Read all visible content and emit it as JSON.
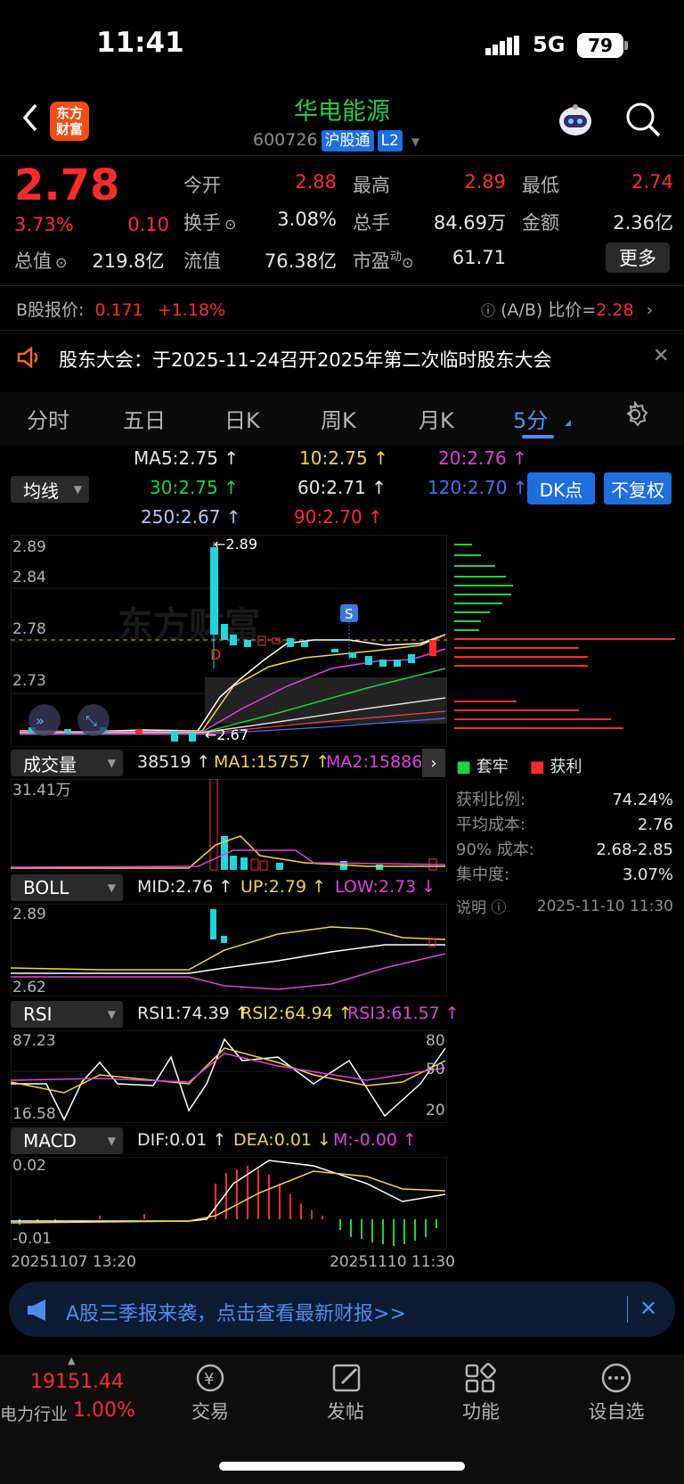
{
  "status": {
    "time": "11:41",
    "network": "5G",
    "battery": "79"
  },
  "header": {
    "logo_line1": "东方",
    "logo_line2": "财富",
    "name": "华电能源",
    "code": "600726",
    "tag1": "沪股通",
    "tag2": "L2"
  },
  "quote": {
    "price": "2.78",
    "pct": "3.73%",
    "chg": "0.10",
    "cap_label": "总值",
    "cap_value": "219.8亿",
    "open_label": "今开",
    "open": "2.88",
    "high_label": "最高",
    "high": "2.89",
    "low_label": "最低",
    "low": "2.74",
    "turnover_label": "换手",
    "turnover": "3.08%",
    "volume_label": "总手",
    "volume": "84.69万",
    "amount_label": "金额",
    "amount": "2.36亿",
    "float_label": "流值",
    "float": "76.38亿",
    "pe_label": "市盈",
    "pe_sup": "动",
    "pe": "61.71",
    "more": "更多"
  },
  "bshare": {
    "label": "B股报价:",
    "price": "0.171",
    "pct": "+1.18%",
    "ratio_label": "(A/B) 比价=",
    "ratio": "2.28"
  },
  "notice": {
    "text": "股东大会：于2025-11-24召开2025年第二次临时股东大会"
  },
  "tabs": [
    "分时",
    "五日",
    "日K",
    "周K",
    "月K",
    "5分"
  ],
  "ma": {
    "selector": "均线",
    "ma5": "MA5:2.75",
    "ma10": "10:2.75",
    "ma20": "20:2.76",
    "ma30": "30:2.75",
    "ma60": "60:2.71",
    "ma120": "120:2.70",
    "ma250": "250:2.67",
    "ma90": "90:2.70",
    "dk": "DK点",
    "fq": "不复权"
  },
  "kchart": {
    "y1": "2.89",
    "y2": "2.84",
    "y3": "2.78",
    "y4": "2.73",
    "high_mark": "2.89",
    "low_mark": "2.67",
    "s_mark": "S",
    "d_mark": "D",
    "watermark": "东方财富"
  },
  "colors": {
    "up": "#ff2b2b",
    "down": "#19d43e",
    "accent": "#1e6ee0"
  },
  "chip": {
    "legend_solid": "套牢",
    "legend_profit": "获利",
    "rows": [
      {
        "label": "获利比例:",
        "value": "74.24%"
      },
      {
        "label": "平均成本:",
        "value": "2.76"
      },
      {
        "label": "90% 成本:",
        "value": "2.68-2.85"
      },
      {
        "label": "集中度:",
        "value": "3.07%"
      }
    ],
    "note": "说明",
    "date": "2025-11-10 11:30"
  },
  "volume": {
    "selector": "成交量",
    "v": "38519",
    "ma1": "MA1:15757",
    "ma2": "MA2:15886",
    "ymax": "31.41万"
  },
  "boll": {
    "selector": "BOLL",
    "mid": "MID:2.76",
    "up": "UP:2.79",
    "low": "LOW:2.73",
    "ymax": "2.89",
    "ymin": "2.62"
  },
  "rsi": {
    "selector": "RSI",
    "rsi1": "RSI1:74.39",
    "rsi2": "RSI2:64.94",
    "rsi3": "RSI3:61.57",
    "ymax": "87.23",
    "ymin": "16.58",
    "l80": "80",
    "l50": "50",
    "l20": "20"
  },
  "macd": {
    "selector": "MACD",
    "dif": "DIF:0.01",
    "dea": "DEA:0.01",
    "m": "M:-0.00",
    "ymax": "0.02",
    "ymin": "-0.01",
    "date_start": "20251107 13:20",
    "date_end": "20251110 11:30"
  },
  "banner": {
    "text": "A股三季报来袭，点击查看最新财报>>"
  },
  "tabbar": {
    "index_value": "19151.44",
    "index_name": "电力行业",
    "index_pct": "1.00%",
    "trade": "交易",
    "post": "发帖",
    "func": "功能",
    "watch": "设自选"
  }
}
